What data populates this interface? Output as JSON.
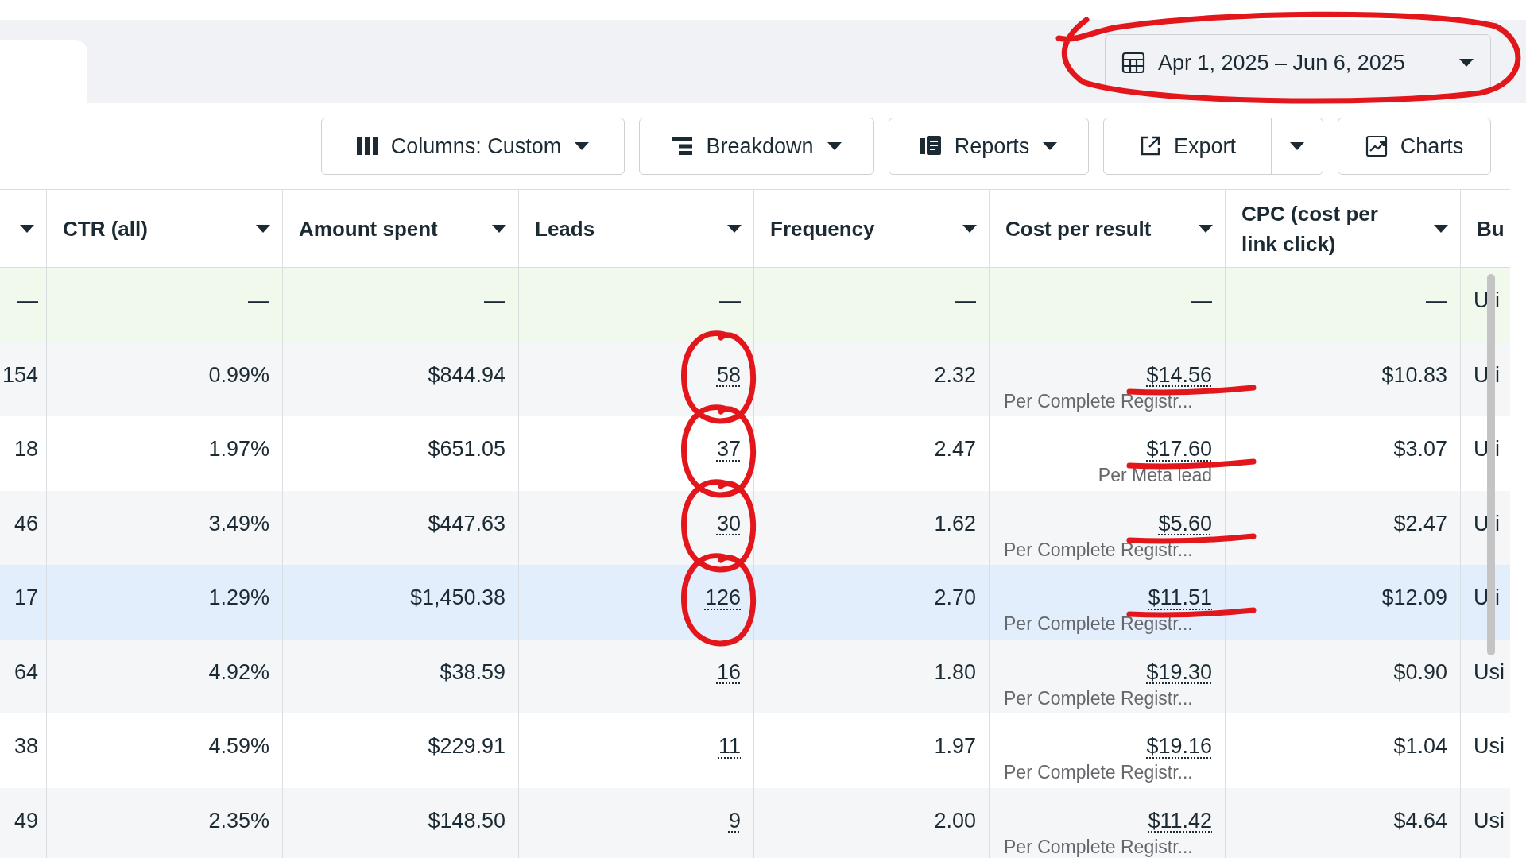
{
  "date_range": {
    "label": "Apr 1, 2025 – Jun 6, 2025",
    "circled": true
  },
  "toolbar": {
    "columns": "Columns: Custom",
    "breakdown": "Breakdown",
    "reports": "Reports",
    "export": "Export",
    "charts": "Charts"
  },
  "table": {
    "columns": [
      "",
      "CTR (all)",
      "Amount spent",
      "Leads",
      "Frequency",
      "Cost per result",
      "CPC (cost per link click)",
      "Bu"
    ],
    "rows": [
      {
        "kind": "summary",
        "selected": false,
        "cells": [
          "—",
          "—",
          "—",
          "—",
          "—",
          "—",
          "—",
          "U i"
        ]
      },
      {
        "kind": "data",
        "selected": false,
        "cells": [
          "154",
          "0.99%",
          "$844.94",
          "58",
          "2.32",
          "$14.56",
          "$10.83",
          "U i"
        ],
        "cost_note": "Per Complete Registr...",
        "circled": true,
        "underlined": true
      },
      {
        "kind": "data",
        "selected": false,
        "cells": [
          "18",
          "1.97%",
          "$651.05",
          "37",
          "2.47",
          "$17.60",
          "$3.07",
          "U i"
        ],
        "cost_note": "Per Meta lead",
        "circled": true,
        "underlined": true
      },
      {
        "kind": "data",
        "selected": false,
        "cells": [
          "46",
          "3.49%",
          "$447.63",
          "30",
          "1.62",
          "$5.60",
          "$2.47",
          "U i"
        ],
        "cost_note": "Per Complete Registr...",
        "circled": true,
        "underlined": true
      },
      {
        "kind": "data",
        "selected": true,
        "cells": [
          "17",
          "1.29%",
          "$1,450.38",
          "126",
          "2.70",
          "$11.51",
          "$12.09",
          "U i"
        ],
        "cost_note": "Per Complete Registr...",
        "circled": true,
        "underlined": true
      },
      {
        "kind": "data",
        "selected": false,
        "cells": [
          "64",
          "4.92%",
          "$38.59",
          "16",
          "1.80",
          "$19.30",
          "$0.90",
          "Usi"
        ],
        "cost_note": "Per Complete Registr..."
      },
      {
        "kind": "data",
        "selected": false,
        "cells": [
          "38",
          "4.59%",
          "$229.91",
          "11",
          "1.97",
          "$19.16",
          "$1.04",
          "Usi"
        ],
        "cost_note": "Per Complete Registr..."
      },
      {
        "kind": "data",
        "selected": false,
        "cells": [
          "49",
          "2.35%",
          "$148.50",
          "9",
          "2.00",
          "$11.42",
          "$4.64",
          "Usi"
        ],
        "cost_note": "Per Complete Registr..."
      }
    ]
  }
}
